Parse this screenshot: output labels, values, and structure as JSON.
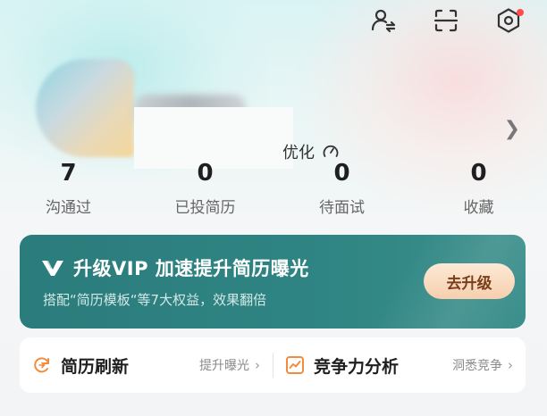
{
  "header": {
    "icons": [
      "user-switch-icon",
      "scan-icon",
      "settings-icon"
    ],
    "settings_has_badge": true
  },
  "profile": {
    "subtitle_visible": "优化"
  },
  "stats": [
    {
      "value": "7",
      "label": "沟通过"
    },
    {
      "value": "0",
      "label": "已投简历"
    },
    {
      "value": "0",
      "label": "待面试"
    },
    {
      "value": "0",
      "label": "收藏"
    }
  ],
  "vip_banner": {
    "title": "升级VIP 加速提升简历曝光",
    "description": "搭配“简历模板“等7大权益，效果翻倍",
    "button_label": "去升级"
  },
  "tools": [
    {
      "title": "简历刷新",
      "hint": "提升曝光",
      "icon": "refresh-icon"
    },
    {
      "title": "竞争力分析",
      "hint": "洞悉竞争",
      "icon": "chart-icon"
    }
  ],
  "colors": {
    "vip_bg": "#2f8583",
    "vip_button": "#f6cfae",
    "accent_orange": "#f28c3c",
    "badge_red": "#ff4d4f"
  }
}
